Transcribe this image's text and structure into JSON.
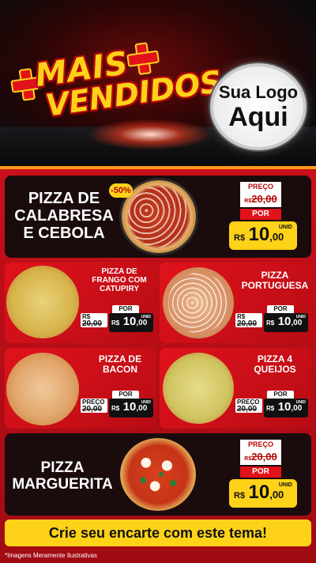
{
  "hero": {
    "title_line1": "MAIS",
    "title_line2": "VENDIDOS",
    "logo_line1": "Sua Logo",
    "logo_line2": "Aqui"
  },
  "featured": [
    {
      "name_l1": "PIZZA DE",
      "name_l2": "CALABRESA",
      "name_l3": "E CEBOLA",
      "discount": "-50%",
      "preco_label": "PREÇO",
      "old_currency": "R$",
      "old_value": "20,00",
      "por_label": "POR",
      "currency": "R$",
      "price_int": "10",
      "price_dec": ",00",
      "unit": "UNID"
    },
    {
      "name_l1": "PIZZA",
      "name_l2": "MARGUERITA",
      "preco_label": "PREÇO",
      "old_currency": "R$",
      "old_value": "20,00",
      "por_label": "POR",
      "currency": "R$",
      "price_int": "10",
      "price_dec": ",00",
      "unit": "UNID"
    }
  ],
  "grid": [
    {
      "name_l1": "PIZZA DE",
      "name_l2": "FRANGO COM",
      "name_l3": "CATUPIRY",
      "old_prefix": "R$",
      "old_value": "20,00",
      "por_label": "POR",
      "currency": "R$",
      "price_int": "10",
      "price_dec": ",00",
      "unit": "UNID"
    },
    {
      "name_l1": "PIZZA",
      "name_l2": "PORTUGUESA",
      "old_prefix": "R$",
      "old_value": "20,00",
      "por_label": "POR",
      "currency": "R$",
      "price_int": "10",
      "price_dec": ",00",
      "unit": "UNID"
    },
    {
      "name_l1": "PIZZA DE",
      "name_l2": "BACON",
      "old_prefix": "PREÇO",
      "old_value": "20,00",
      "por_label": "POR",
      "currency": "R$",
      "price_int": "10",
      "price_dec": ",00",
      "unit": "UNID"
    },
    {
      "name_l1": "PIZZA 4",
      "name_l2": "QUEIJOS",
      "old_prefix": "PREÇO",
      "old_value": "20,00",
      "por_label": "POR",
      "currency": "R$",
      "price_int": "10",
      "price_dec": ",00",
      "unit": "UNID"
    }
  ],
  "cta": "Crie seu encarte com este tema!",
  "footnote": "*Imagens Meramente Ilustrativas"
}
